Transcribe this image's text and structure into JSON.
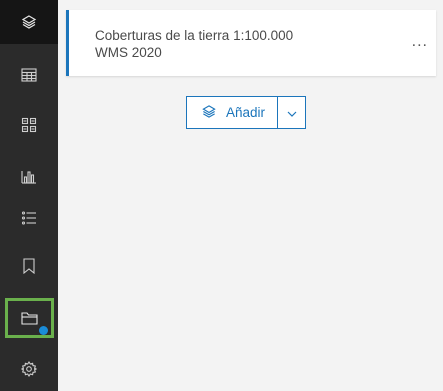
{
  "sidebar": {
    "items": [
      {
        "icon": "layers-icon",
        "active": true
      },
      {
        "icon": "table-icon"
      },
      {
        "icon": "grid-icon"
      },
      {
        "icon": "bar-chart-icon"
      },
      {
        "icon": "list-icon"
      },
      {
        "icon": "bookmark-icon"
      },
      {
        "icon": "folder-icon",
        "selected": true,
        "badge_color": "#1a8cd8"
      },
      {
        "icon": "gear-icon"
      }
    ]
  },
  "layer": {
    "title_line1": "Coberturas de la tierra 1:100.000",
    "title_line2": "WMS 2020",
    "menu": "..."
  },
  "add": {
    "label": "Añadir"
  },
  "colors": {
    "accent": "#1b75bb",
    "sidebar_bg": "#2b2b2b",
    "selected_border": "#6ab04c"
  }
}
